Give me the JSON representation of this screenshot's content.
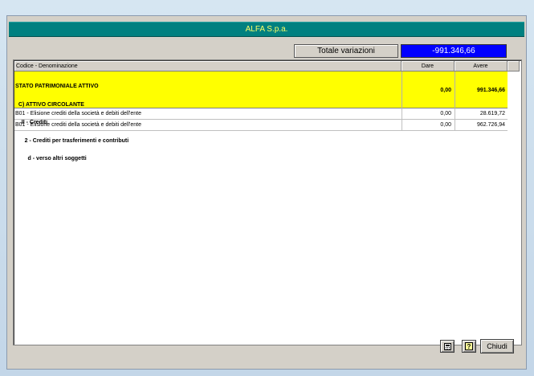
{
  "window": {
    "title": "ALFA S.p.a."
  },
  "totale": {
    "label": "Totale variazioni",
    "value": "-991.346,66"
  },
  "grid": {
    "headers": [
      "Codice - Denominazione",
      "Dare",
      "Avere"
    ],
    "group": {
      "lines": [
        "STATO PATRIMONIALE ATTIVO",
        "  C) ATTIVO CIRCOLANTE",
        "    II - Crediti",
        "      2 - Crediti per trasferimenti e contributi",
        "        d - verso altri soggetti"
      ],
      "dare": "0,00",
      "avere": "991.346,66"
    },
    "rows": [
      {
        "desc": "B01 - Elisione crediti della società e debiti dell'ente",
        "dare": "0,00",
        "avere": "28.619,72"
      },
      {
        "desc": "B01 - Elisione crediti della società e debiti dell'ente",
        "dare": "0,00",
        "avere": "962.726,94"
      }
    ]
  },
  "buttons": {
    "calc_icon": "calculator-icon",
    "help_icon": "help-icon",
    "help_glyph": "?",
    "close_label": "Chiudi"
  }
}
